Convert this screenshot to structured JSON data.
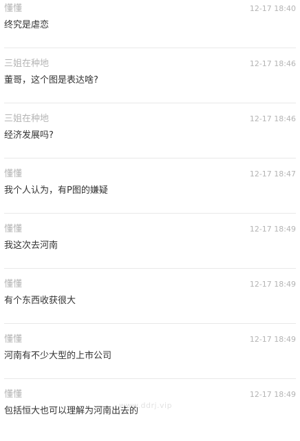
{
  "comments": [
    {
      "author": "懂懂",
      "time": "12-17 18:40",
      "content": "终究是虐恋"
    },
    {
      "author": "三姐在种地",
      "time": "12-17 18:46",
      "content": "董哥，这个图是表达啥?"
    },
    {
      "author": "三姐在种地",
      "time": "12-17 18:46",
      "content": "经济发展吗?"
    },
    {
      "author": "懂懂",
      "time": "12-17 18:47",
      "content": "我个人认为，有P图的嫌疑"
    },
    {
      "author": "懂懂",
      "time": "12-17 18:49",
      "content": "我这次去河南"
    },
    {
      "author": "懂懂",
      "time": "12-17 18:49",
      "content": "有个东西收获很大"
    },
    {
      "author": "懂懂",
      "time": "12-17 18:49",
      "content": "河南有不少大型的上市公司"
    },
    {
      "author": "懂懂",
      "time": "12-17 18:49",
      "content": "包括恒大也可以理解为河南出去的"
    }
  ],
  "watermark": "www.ddrj.vip"
}
